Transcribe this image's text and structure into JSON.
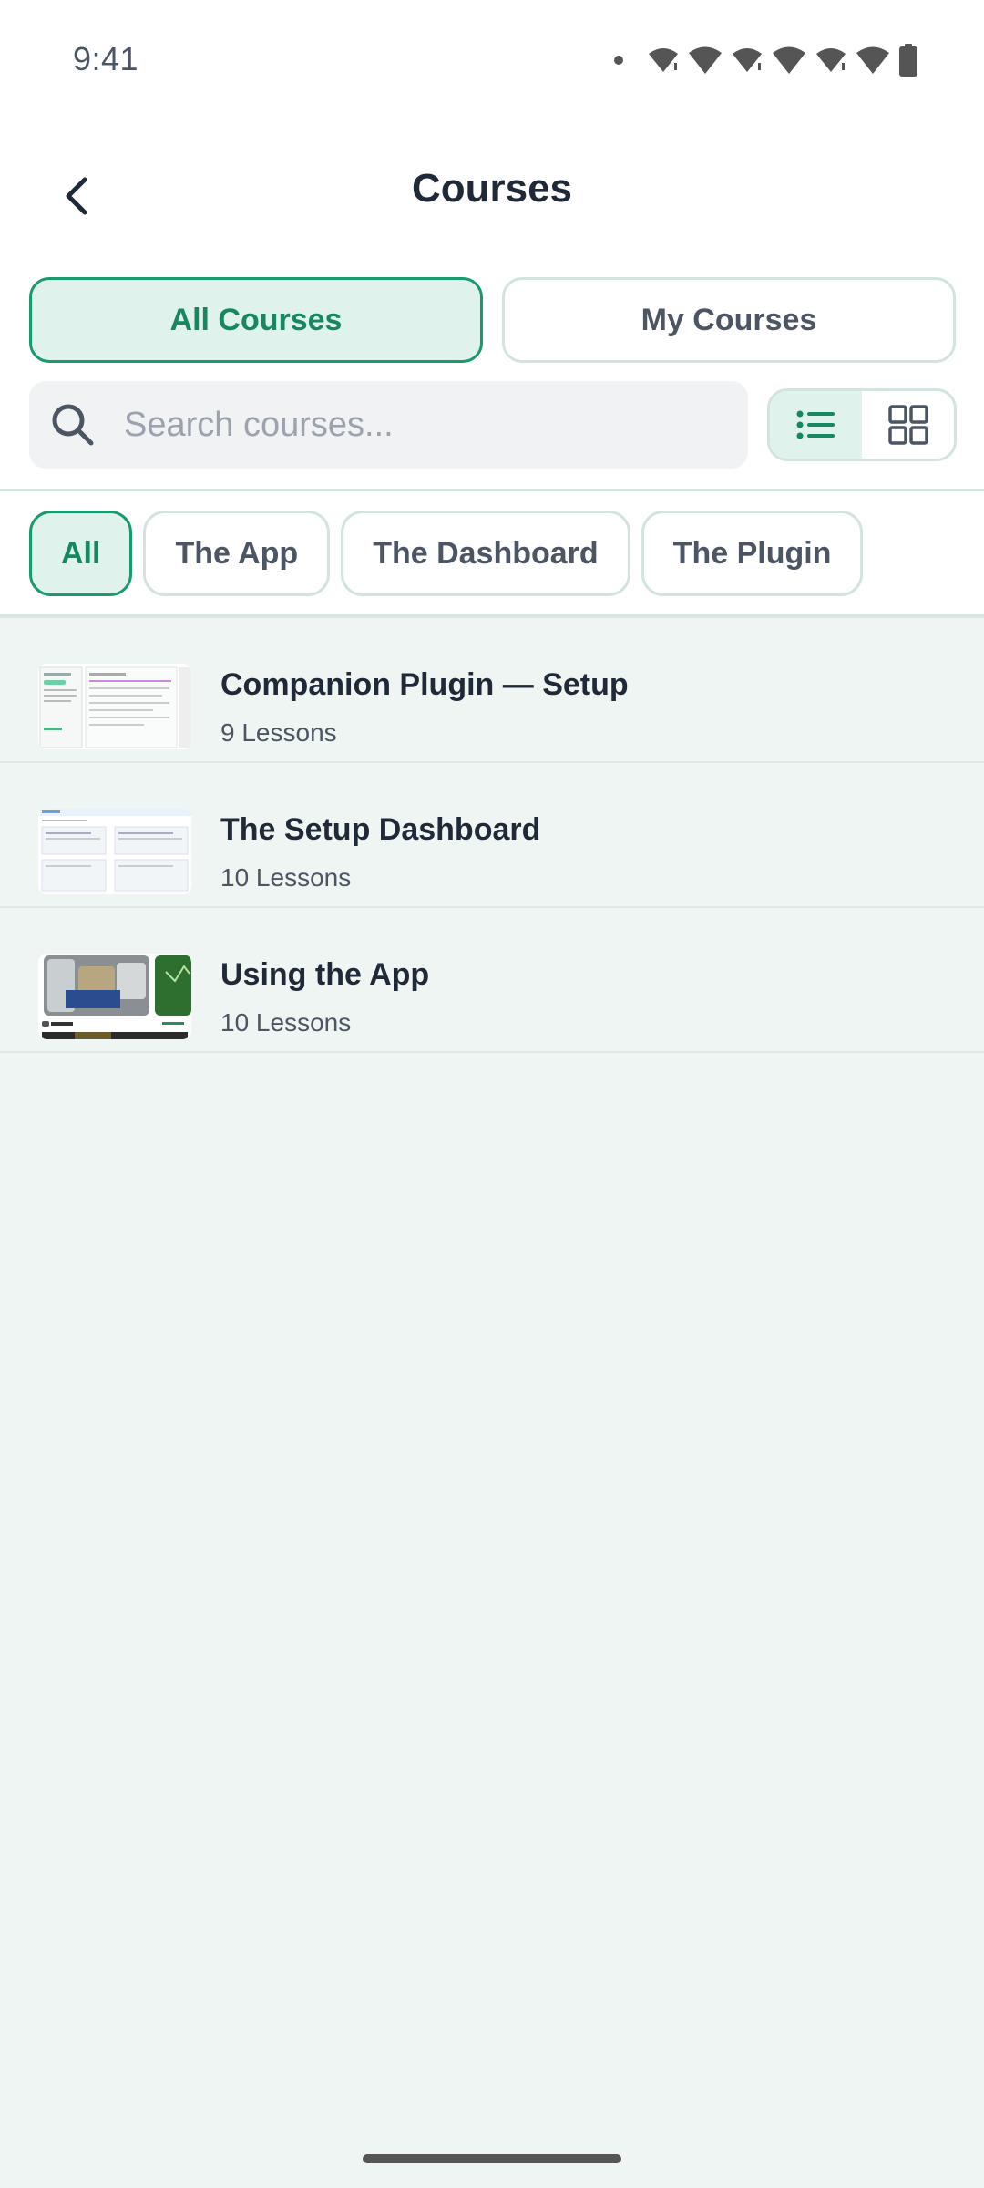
{
  "status_bar": {
    "time": "9:41"
  },
  "header": {
    "title": "Courses",
    "back_icon": "chevron-left-icon"
  },
  "segments": {
    "all_label": "All Courses",
    "my_label": "My Courses",
    "selected": "All Courses"
  },
  "search": {
    "placeholder": "Search courses...",
    "value": ""
  },
  "view_toggle": {
    "selected": "list",
    "options": [
      "list-icon",
      "grid-icon"
    ]
  },
  "filters": {
    "chips": [
      {
        "label": "All",
        "active": true
      },
      {
        "label": "The App",
        "active": false
      },
      {
        "label": "The Dashboard",
        "active": false
      },
      {
        "label": "The Plugin",
        "active": false
      }
    ]
  },
  "courses": [
    {
      "title": "Companion Plugin — Setup",
      "lessons": "9 Lessons"
    },
    {
      "title": "The Setup Dashboard",
      "lessons": "10 Lessons"
    },
    {
      "title": "Using the App",
      "lessons": "10 Lessons"
    }
  ],
  "colors": {
    "accent": "#1a9a6c",
    "accent_bg": "#e0f2ec",
    "page_bg": "#eff5f3"
  }
}
